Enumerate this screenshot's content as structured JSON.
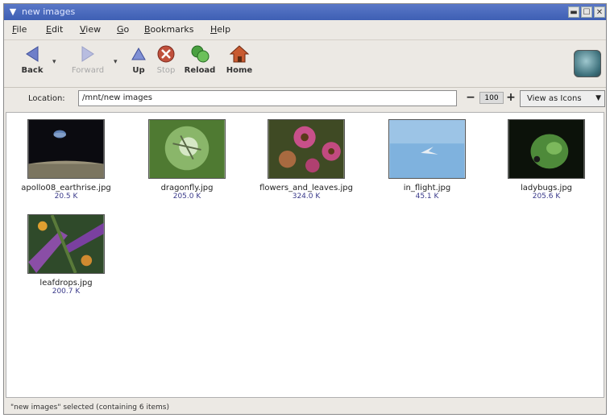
{
  "window": {
    "title": "new images"
  },
  "menu": [
    "File",
    "Edit",
    "View",
    "Go",
    "Bookmarks",
    "Help"
  ],
  "toolbar": {
    "back": "Back",
    "forward": "Forward",
    "up": "Up",
    "stop": "Stop",
    "reload": "Reload",
    "home": "Home"
  },
  "location": {
    "label": "Location:",
    "value": "/mnt/new images",
    "zoom": "100",
    "view_as": "View as Icons"
  },
  "files": [
    {
      "name": "apollo08_earthrise.jpg",
      "size": "20.5 K"
    },
    {
      "name": "dragonfly.jpg",
      "size": "205.0 K"
    },
    {
      "name": "flowers_and_leaves.jpg",
      "size": "324.0 K"
    },
    {
      "name": "in_flight.jpg",
      "size": "45.1 K"
    },
    {
      "name": "ladybugs.jpg",
      "size": "205.6 K"
    },
    {
      "name": "leafdrops.jpg",
      "size": "200.7 K"
    }
  ],
  "status": "\"new images\" selected (containing 6 items)"
}
